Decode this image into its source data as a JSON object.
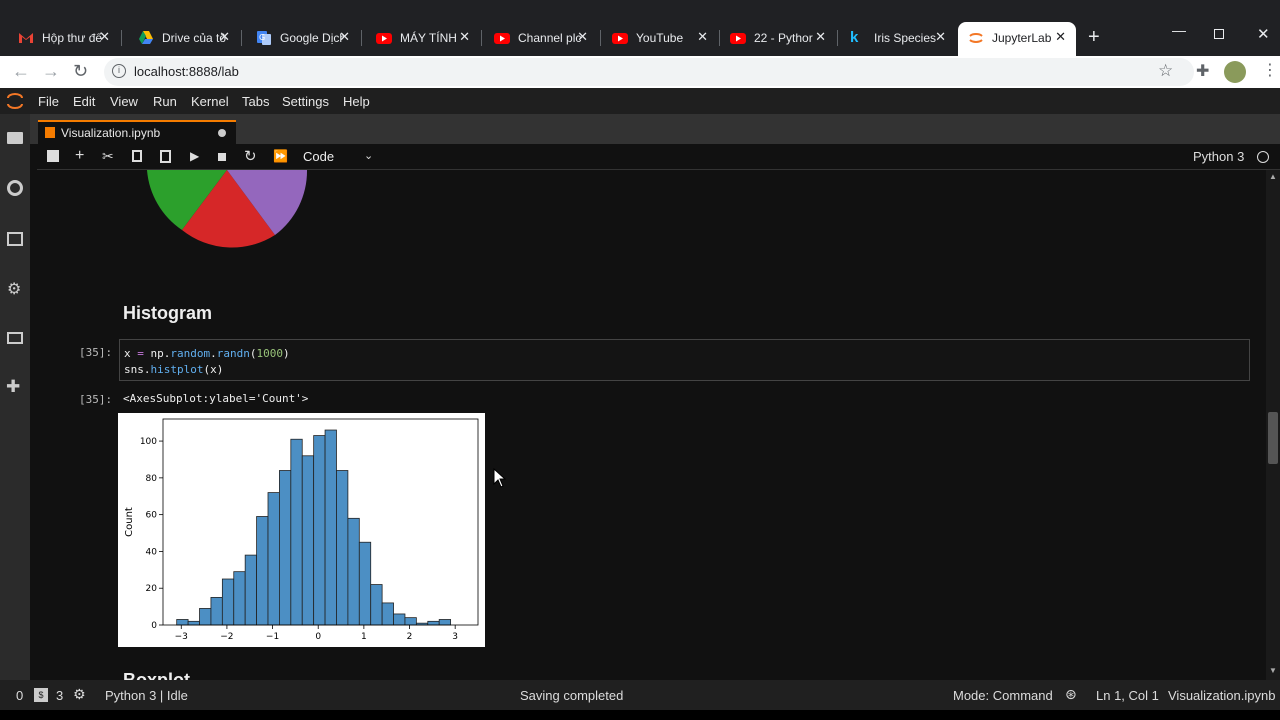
{
  "browser": {
    "tabs": [
      {
        "title": "Hộp thư đế",
        "icon": "gmail-icon"
      },
      {
        "title": "Drive của tô",
        "icon": "google-drive-icon"
      },
      {
        "title": "Google Dịch",
        "icon": "google-translate-icon"
      },
      {
        "title": "MÁY TÍNH",
        "icon": "youtube-icon"
      },
      {
        "title": "Channel plc",
        "icon": "youtube-icon"
      },
      {
        "title": "YouTube",
        "icon": "youtube-icon"
      },
      {
        "title": "22 - Pythor",
        "icon": "youtube-icon"
      },
      {
        "title": "Iris Species",
        "icon": "kaggle-icon"
      },
      {
        "title": "JupyterLab",
        "icon": "jupyter-icon"
      }
    ],
    "url": "localhost:8888/lab"
  },
  "menu": [
    "File",
    "Edit",
    "View",
    "Run",
    "Kernel",
    "Tabs",
    "Settings",
    "Help"
  ],
  "doc_tab": {
    "title": "Visualization.ipynb"
  },
  "toolbar": {
    "cell_type": "Code",
    "kernel": "Python 3"
  },
  "notebook": {
    "heading": "Histogram",
    "in_prompt": "[35]:",
    "out_prompt": "[35]:",
    "code_line1": [
      "x ",
      "=",
      " np",
      ".",
      "random",
      ".",
      "randn",
      "(",
      "1000",
      ")"
    ],
    "code_line2": [
      "sns",
      ".",
      "histplot",
      "(",
      "x",
      ")"
    ],
    "output_text": "<AxesSubplot:ylabel='Count'>",
    "next_heading_partial": "Boxplot"
  },
  "status": {
    "left_num1": "0",
    "left_num2": "3",
    "kernel_status": "Python 3 | Idle",
    "center": "Saving completed",
    "mode": "Mode: Command",
    "position": "Ln 1, Col 1",
    "file": "Visualization.ipynb"
  },
  "chart_data": {
    "type": "bar",
    "title": "",
    "xlabel": "",
    "ylabel": "Count",
    "xlim": [
      -3.4,
      3.5
    ],
    "ylim": [
      0,
      112
    ],
    "xticks": [
      "−3",
      "−2",
      "−1",
      "0",
      "1",
      "2",
      "3"
    ],
    "xtick_values": [
      -3,
      -2,
      -1,
      0,
      1,
      2,
      3
    ],
    "yticks": [
      "0",
      "20",
      "40",
      "60",
      "80",
      "100"
    ],
    "ytick_values": [
      0,
      20,
      40,
      60,
      80,
      100
    ],
    "bin_edges": [
      -3.1,
      -2.85,
      -2.6,
      -2.35,
      -2.1,
      -1.85,
      -1.6,
      -1.35,
      -1.1,
      -0.85,
      -0.6,
      -0.35,
      -0.1,
      0.15,
      0.4,
      0.65,
      0.9,
      1.15,
      1.4,
      1.65,
      1.9,
      2.15,
      2.4,
      2.65,
      2.9,
      3.15
    ],
    "values": [
      3,
      2,
      9,
      15,
      25,
      29,
      38,
      59,
      72,
      84,
      101,
      92,
      103,
      106,
      84,
      58,
      45,
      22,
      12,
      6,
      4,
      1,
      2,
      3,
      0
    ],
    "bar_color": "#4c8fc4",
    "grid": false
  },
  "pie_colors": [
    "#2ca02c",
    "#d62728",
    "#9467bd"
  ]
}
